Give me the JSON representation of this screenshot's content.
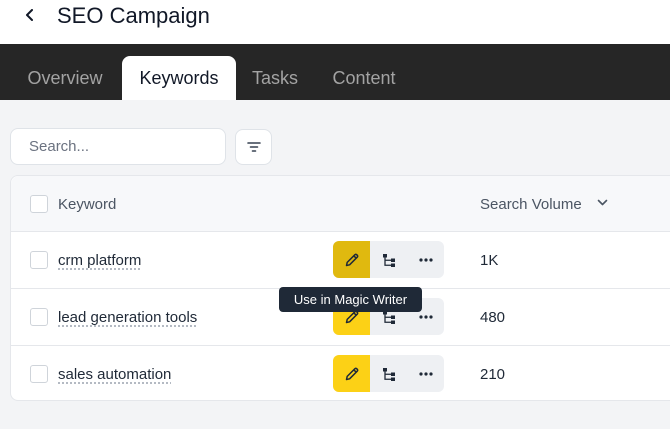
{
  "header": {
    "title": "SEO Campaign",
    "back_icon": "chevron-left-icon"
  },
  "tabs": [
    {
      "label": "Overview",
      "active": false
    },
    {
      "label": "Keywords",
      "active": true
    },
    {
      "label": "Tasks",
      "active": false
    },
    {
      "label": "Content",
      "active": false
    }
  ],
  "search": {
    "placeholder": "Search...",
    "value": ""
  },
  "filter": {
    "icon": "filter-icon"
  },
  "table": {
    "columns": {
      "keyword": "Keyword",
      "search_volume": "Search Volume"
    },
    "sort_icon": "chevron-down-icon",
    "rows": [
      {
        "keyword": "crm platform",
        "search_volume": "1K"
      },
      {
        "keyword": "lead generation tools",
        "search_volume": "480"
      },
      {
        "keyword": "sales automation",
        "search_volume": "210"
      }
    ],
    "row_actions": [
      "pencil-icon",
      "hierarchy-icon",
      "more-icon"
    ]
  },
  "tooltip": {
    "text": "Use in Magic Writer"
  },
  "colors": {
    "accent": "#fcd116",
    "tabbar": "#262626",
    "tooltip": "#1f2937"
  }
}
